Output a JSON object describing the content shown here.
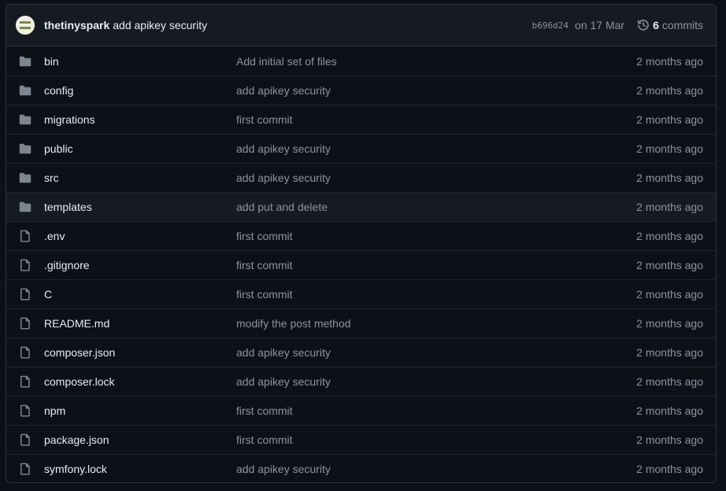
{
  "latest_commit": {
    "author": "thetinyspark",
    "message": "add apikey security",
    "sha": "b696d24",
    "date": "on 17 Mar",
    "commits_count": "6",
    "commits_label": "commits",
    "history_icon": "history-icon"
  },
  "files": [
    {
      "type": "folder",
      "name": "bin",
      "message": "Add initial set of files",
      "age": "2 months ago"
    },
    {
      "type": "folder",
      "name": "config",
      "message": "add apikey security",
      "age": "2 months ago"
    },
    {
      "type": "folder",
      "name": "migrations",
      "message": "first commit",
      "age": "2 months ago"
    },
    {
      "type": "folder",
      "name": "public",
      "message": "add apikey security",
      "age": "2 months ago"
    },
    {
      "type": "folder",
      "name": "src",
      "message": "add apikey security",
      "age": "2 months ago"
    },
    {
      "type": "folder",
      "name": "templates",
      "message": "add put and delete",
      "age": "2 months ago",
      "hovered": true
    },
    {
      "type": "file",
      "name": ".env",
      "message": "first commit",
      "age": "2 months ago"
    },
    {
      "type": "file",
      "name": ".gitignore",
      "message": "first commit",
      "age": "2 months ago"
    },
    {
      "type": "file",
      "name": "C",
      "message": "first commit",
      "age": "2 months ago"
    },
    {
      "type": "file",
      "name": "README.md",
      "message": "modify the post method",
      "age": "2 months ago"
    },
    {
      "type": "file",
      "name": "composer.json",
      "message": "add apikey security",
      "age": "2 months ago"
    },
    {
      "type": "file",
      "name": "composer.lock",
      "message": "add apikey security",
      "age": "2 months ago"
    },
    {
      "type": "file",
      "name": "npm",
      "message": "first commit",
      "age": "2 months ago"
    },
    {
      "type": "file",
      "name": "package.json",
      "message": "first commit",
      "age": "2 months ago"
    },
    {
      "type": "file",
      "name": "symfony.lock",
      "message": "add apikey security",
      "age": "2 months ago"
    }
  ],
  "colors": {
    "background": "#0d1117",
    "header_bg": "#161b22",
    "border": "#30363d",
    "folder_icon": "#7d8590",
    "text_primary": "#e6edf3",
    "text_muted": "#8b949e"
  }
}
